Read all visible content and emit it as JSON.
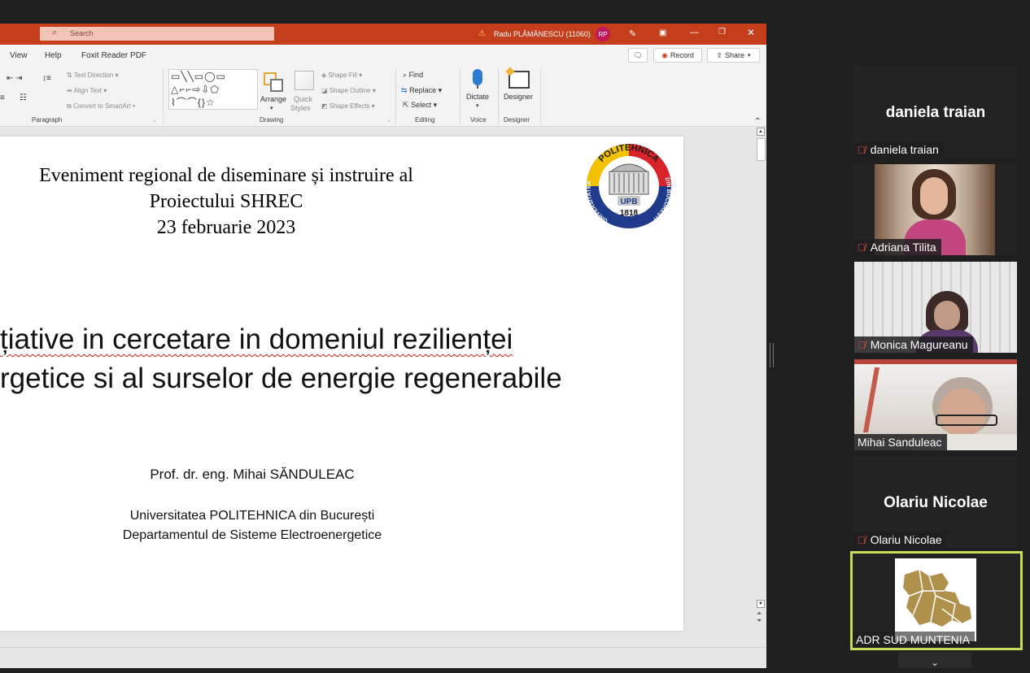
{
  "titlebar": {
    "search_placeholder": "Search",
    "user": "Radu PLĂMĂNESCU (11060)",
    "avatar": "RP",
    "warning_icon": "warning-icon"
  },
  "tabs": [
    "View",
    "Help",
    "Foxit Reader PDF"
  ],
  "actions": {
    "record": "Record",
    "share": "Share"
  },
  "ribbon": {
    "paragraph": {
      "label": "Paragraph",
      "text_direction": "Text Direction",
      "align_text": "Align Text",
      "convert_smartart": "Convert to SmartArt"
    },
    "drawing": {
      "label": "Drawing",
      "arrange": "Arrange",
      "quick_styles_1": "Quick",
      "quick_styles_2": "Styles",
      "shape_fill": "Shape Fill",
      "shape_outline": "Shape Outline",
      "shape_effects": "Shape Effects"
    },
    "editing": {
      "label": "Editing",
      "find": "Find",
      "replace": "Replace",
      "select": "Select"
    },
    "voice": {
      "label": "Voice",
      "dictate": "Dictate"
    },
    "designer": {
      "label": "Designer",
      "designer": "Designer"
    }
  },
  "slide": {
    "header_line1": "Eveniment regional de diseminare și instruire al",
    "header_line2": "Proiectului SHREC",
    "header_line3": "23 februarie 2023",
    "title_line1": "țiative in cercetare in domeniul rezilienței",
    "title_line2": "rgetice si al surselor de energie regenerabile",
    "author": "Prof. dr. eng. Mihai SĂNDULEAC",
    "affil1": "Universitatea POLITEHNICA din București",
    "affil2": "Departamentul de Sisteme Electroenergetice",
    "logo": {
      "top": "POLITEHNICA",
      "left": "UNIVERSITATEA",
      "right": "DIN BUCUREȘTI",
      "center": "UPB",
      "year": "1818"
    }
  },
  "participants": [
    {
      "name": "daniela traian",
      "display": "daniela traian",
      "video": false,
      "muted": true
    },
    {
      "name": "Adriana Tilita",
      "video": true,
      "muted": true
    },
    {
      "name": "Monica Magureanu",
      "video": true,
      "muted": true
    },
    {
      "name": "Mihai Sanduleac",
      "video": true,
      "muted": false
    },
    {
      "name": "Olariu Nicolae",
      "display": "Olariu Nicolae",
      "video": false,
      "muted": true
    },
    {
      "name": "ADR SUD MUNTENIA",
      "video": true,
      "muted": false,
      "active_speaker": true
    }
  ],
  "colors": {
    "titlebar": "#c43e1c",
    "active_speaker": "#c8dc5a",
    "mute": "#e0493a"
  }
}
